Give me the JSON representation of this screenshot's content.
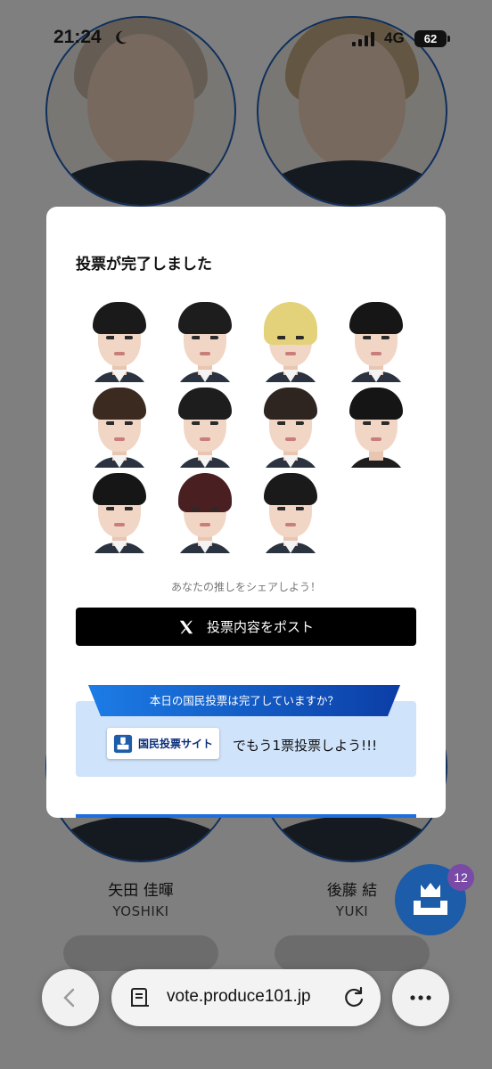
{
  "status_bar": {
    "time": "21:24",
    "network": "4G",
    "battery": "62"
  },
  "background": {
    "members": [
      {
        "name": "矢田 佳暉",
        "roman": "YOSHIKI"
      },
      {
        "name": "後藤 結",
        "roman": "YUKI"
      }
    ]
  },
  "modal": {
    "title": "投票が完了しました",
    "share_hint": "あなたの推しをシェアしよう！",
    "post_button": "投票内容をポスト",
    "vote_question": "本日の国民投票は完了していますか？",
    "site_button": "国民投票サイト",
    "vote_tagline": "でもう1票投票しよう!!!"
  },
  "float_badge": {
    "count": "12"
  },
  "browser": {
    "url": "vote.produce101.jp"
  },
  "colors": {
    "accent": "#1d6fe0",
    "ribbon_dark": "#0b3ea6",
    "vote_box": "#cfe3fb",
    "badge": "#7a4ba6"
  }
}
